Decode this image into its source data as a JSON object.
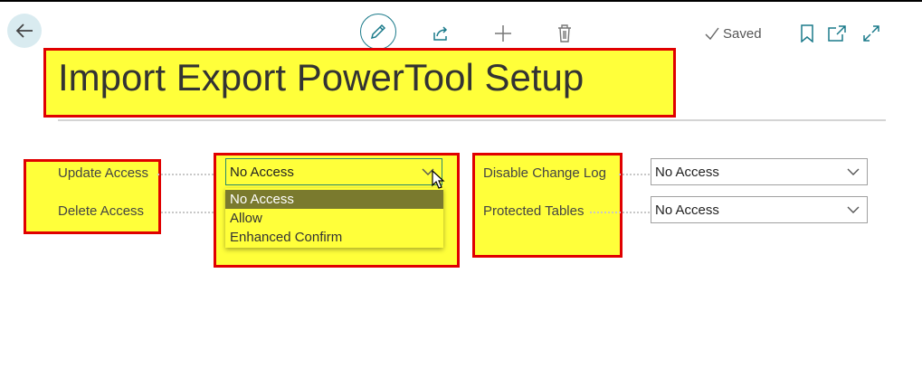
{
  "header": {
    "saved_label": "Saved"
  },
  "page": {
    "title": "Import Export PowerTool Setup"
  },
  "fields": {
    "update_access": {
      "label": "Update Access",
      "value": "No Access"
    },
    "delete_access": {
      "label": "Delete Access"
    },
    "disable_change_log": {
      "label": "Disable Change Log",
      "value": "No Access"
    },
    "protected_tables": {
      "label": "Protected Tables",
      "value": "No Access"
    }
  },
  "dropdown": {
    "options": [
      "No Access",
      "Allow",
      "Enhanced Confirm"
    ],
    "selected": "No Access"
  },
  "icons": [
    "back-arrow-icon",
    "edit-icon",
    "share-icon",
    "plus-icon",
    "trash-icon",
    "checkmark-icon",
    "bookmark-icon",
    "popout-icon",
    "expand-icon",
    "chevron-down-icon",
    "mouse-cursor-icon"
  ],
  "colors": {
    "accent": "#1a7a8a",
    "highlight": "#ffff3a",
    "annotation_border": "#e00000",
    "selected_option": "#7a7a2e"
  }
}
